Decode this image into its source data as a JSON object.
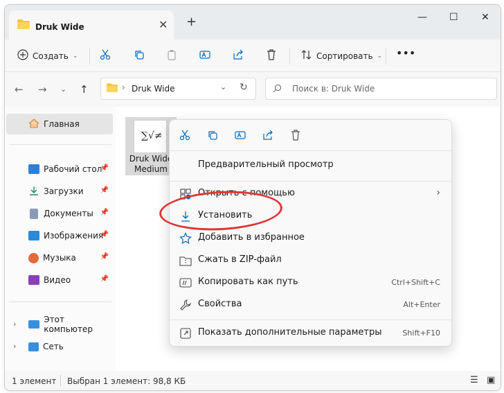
{
  "window": {
    "tab_title": "Druk Wide"
  },
  "toolbar": {
    "create_label": "Создать",
    "sort_label": "Сортировать"
  },
  "address": {
    "path": "Druk Wide",
    "search_placeholder": "Поиск в: Druk Wide"
  },
  "sidebar": {
    "items": [
      {
        "label": "Главная"
      },
      {
        "label": "Рабочий стол"
      },
      {
        "label": "Загрузки"
      },
      {
        "label": "Документы"
      },
      {
        "label": "Изображения"
      },
      {
        "label": "Музыка"
      },
      {
        "label": "Видео"
      },
      {
        "label": "Этот компьютер"
      },
      {
        "label": "Сеть"
      }
    ]
  },
  "file": {
    "glyph": "∑√≠",
    "name_line1": "Druk Wide",
    "name_line2": "Medium"
  },
  "context_menu": {
    "items": [
      {
        "label": "Предварительный просмотр",
        "shortcut": ""
      },
      {
        "label": "Открыть с помощью",
        "shortcut": ""
      },
      {
        "label": "Установить",
        "shortcut": ""
      },
      {
        "label": "Добавить в избранное",
        "shortcut": ""
      },
      {
        "label": "Сжать в ZIP-файл",
        "shortcut": ""
      },
      {
        "label": "Копировать как путь",
        "shortcut": "Ctrl+Shift+C"
      },
      {
        "label": "Свойства",
        "shortcut": "Alt+Enter"
      },
      {
        "label": "Показать дополнительные параметры",
        "shortcut": "Shift+F10"
      }
    ]
  },
  "status": {
    "count": "1 элемент",
    "selected": "Выбран 1 элемент: 98,8 КБ"
  },
  "colors": {
    "accent": "#0067c0",
    "highlight": "#e03535",
    "folder": "#f4c542"
  }
}
